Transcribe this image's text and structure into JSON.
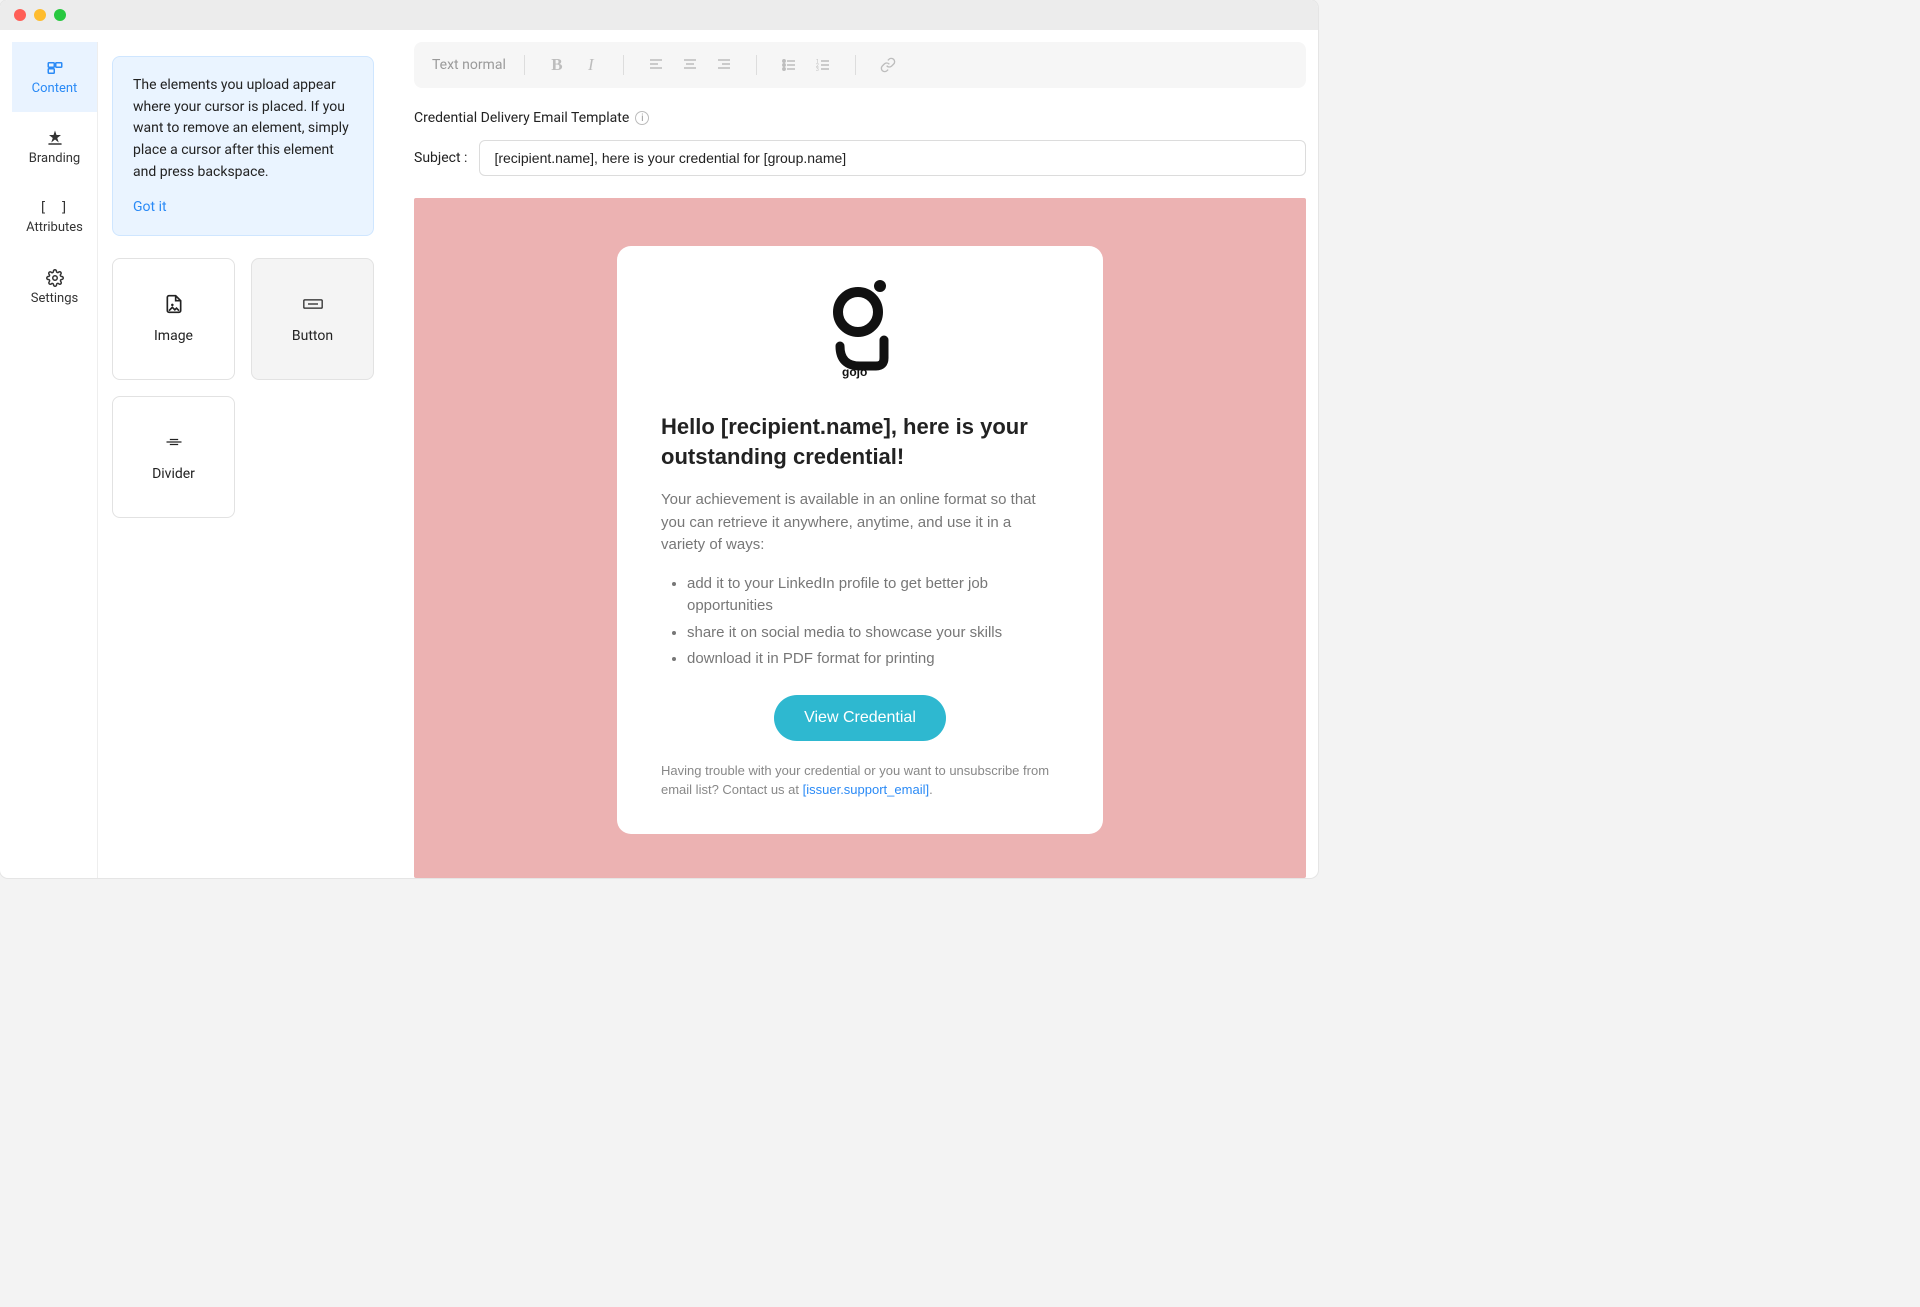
{
  "sidebar": {
    "content": "Content",
    "branding": "Branding",
    "attributes": "Attributes",
    "settings": "Settings"
  },
  "info": {
    "text": "The elements you upload appear where your cursor is placed. If you want to remove an element, simply place a cursor after this element and press backspace.",
    "dismiss": "Got it"
  },
  "elements": {
    "image": "Image",
    "button": "Button",
    "divider": "Divider"
  },
  "toolbar": {
    "text_style": "Text normal"
  },
  "template": {
    "header": "Credential Delivery Email Template",
    "subject_label": "Subject :",
    "subject_value": "[recipient.name], here is your credential for [group.name]"
  },
  "email": {
    "logo_text": "gojo",
    "heading": "Hello [recipient.name], here is your outstanding credential!",
    "intro": "Your achievement is available in an online format so that you can retrieve it anywhere, anytime, and use it in a variety of ways:",
    "bullets": [
      "add it to your LinkedIn profile to get better job opportunities",
      "share it on social media to showcase your skills",
      "download it in PDF format for printing"
    ],
    "cta": "View Credential",
    "footer_pre": "Having trouble with your credential or you want to unsubscribe from email list? Contact us at ",
    "footer_link": "[issuer.support_email]",
    "footer_post": "."
  }
}
